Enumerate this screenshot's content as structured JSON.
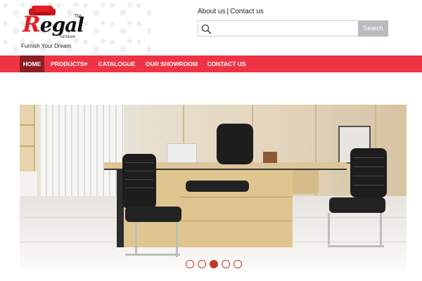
{
  "brand": {
    "name_initial": "R",
    "name_rest": "egal",
    "trademark": "TM",
    "subtitle": "furniture",
    "tagline": "Furnish Your Dream"
  },
  "top_links": {
    "about": "About us",
    "separator": "|",
    "contact": "Contact us"
  },
  "search": {
    "placeholder": "",
    "value": "",
    "button_label": "Search"
  },
  "nav": {
    "items": [
      {
        "label": "HOME",
        "active": true
      },
      {
        "label": "PRODUCTS",
        "active": false
      },
      {
        "label": "CATALOGUE",
        "active": false
      },
      {
        "label": "OUR SHOWROOM",
        "active": false
      },
      {
        "label": "CONTACT US",
        "active": false
      }
    ],
    "products_caret": "▾"
  },
  "slider": {
    "slide_count": 5,
    "active_index": 2
  },
  "colors": {
    "brand_red": "#ee3344",
    "nav_active": "#8c1d20",
    "search_button": "#b9bcbf",
    "indicator": "#c0392b"
  },
  "icons": {
    "search": "search-icon",
    "logo": "sofa-logo-icon"
  }
}
